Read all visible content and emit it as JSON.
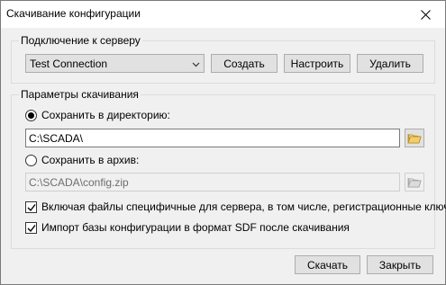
{
  "window": {
    "title": "Скачивание конфигурации"
  },
  "server_group": {
    "legend": "Подключение к серверу",
    "connection": {
      "selected": "Test Connection"
    },
    "buttons": {
      "create": "Создать",
      "configure": "Настроить",
      "delete": "Удалить"
    }
  },
  "download_group": {
    "legend": "Параметры скачивания",
    "save_to_dir": {
      "label": "Сохранить в директорию:",
      "checked": true,
      "path": "C:\\SCADA\\"
    },
    "save_to_archive": {
      "label": "Сохранить в архив:",
      "checked": false,
      "path": "C:\\SCADA\\config.zip"
    },
    "include_server_files": {
      "label": "Включая файлы специфичные для сервера, в том числе, регистрационные ключи",
      "checked": true
    },
    "import_sdf": {
      "label": "Импорт базы конфигурации в формат SDF после скачивания",
      "checked": true
    }
  },
  "footer": {
    "download": "Скачать",
    "close": "Закрыть"
  },
  "icons": {
    "close": "close-icon",
    "dropdown": "chevron-down-icon",
    "folder": "folder-open-icon",
    "checkmark": "checkmark-icon"
  },
  "colors": {
    "folder": "#e8b84a",
    "window_bg": "#f0f0f0"
  }
}
